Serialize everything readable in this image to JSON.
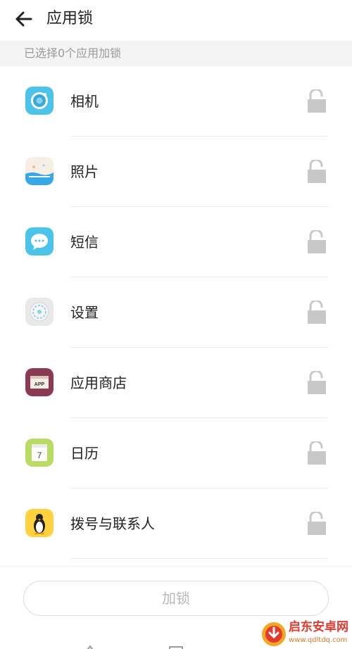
{
  "header": {
    "title": "应用锁",
    "back_icon": "arrow-left-icon"
  },
  "subheader": {
    "text": "已选择0个应用加锁"
  },
  "apps": [
    {
      "name": "相机",
      "icon": "camera-icon"
    },
    {
      "name": "照片",
      "icon": "photos-icon"
    },
    {
      "name": "短信",
      "icon": "messages-icon"
    },
    {
      "name": "设置",
      "icon": "settings-icon"
    },
    {
      "name": "应用商店",
      "icon": "app-store-icon",
      "icon_text": "APP"
    },
    {
      "name": "日历",
      "icon": "calendar-icon",
      "icon_text": "7"
    },
    {
      "name": "拨号与联系人",
      "icon": "dialer-contacts-icon"
    }
  ],
  "lock_button": {
    "label": "加锁"
  },
  "watermark": {
    "text": "启东安卓网",
    "url": "www.qdltdq.com"
  },
  "colors": {
    "lock_gray": "#c8c8c8",
    "subheader_bg": "#f4f4f4",
    "watermark_red": "#e23a2e"
  }
}
